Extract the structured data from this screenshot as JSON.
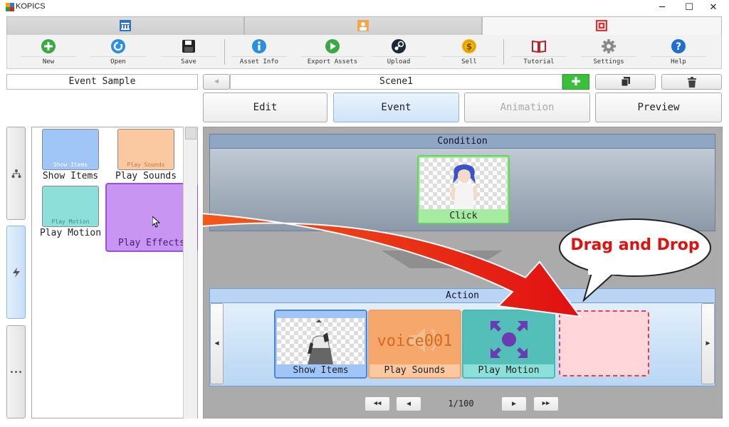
{
  "window": {
    "title": "KOPICS",
    "minimize": "─",
    "maximize": "☐",
    "close": "✕"
  },
  "toolbar": {
    "new": "New",
    "open": "Open",
    "save": "Save",
    "asset_info": "Asset Info",
    "export_assets": "Export Assets",
    "upload": "Upload",
    "sell": "Sell",
    "tutorial": "Tutorial",
    "settings": "Settings",
    "help": "Help"
  },
  "project": {
    "name": "Event Sample"
  },
  "scene": {
    "name": "Scene1",
    "prev": "◀",
    "add": "✚"
  },
  "modes": {
    "edit": "Edit",
    "event": "Event",
    "animation": "Animation",
    "preview": "Preview"
  },
  "palette": {
    "items": [
      {
        "mini": "Show Items",
        "label": "Show Items",
        "color": "#9fc6f7"
      },
      {
        "mini": "Play Sounds",
        "label": "Play Sounds",
        "color": "#fbc9a1"
      },
      {
        "mini": "Play Motion",
        "label": "Play Motion",
        "color": "#8ddfd9"
      },
      {
        "mini": "",
        "label": "Play Effects",
        "color": "#c896f2"
      }
    ]
  },
  "condition": {
    "title": "Condition",
    "card_label": "Click"
  },
  "action": {
    "title": "Action",
    "cards": [
      {
        "label": "Show Items"
      },
      {
        "label": "Play Sounds",
        "text": "voice001"
      },
      {
        "label": "Play Motion"
      }
    ],
    "left_arrow": "◀",
    "right_arrow": "▶"
  },
  "callout": {
    "text": "Drag and Drop"
  },
  "pager": {
    "first": "◀◀",
    "prev": "◀",
    "text": "1/100",
    "next": "▶",
    "last": "▶▶"
  },
  "sidebar": {
    "tool3": "•••"
  },
  "colors": {
    "accent_blue": "#d6e8fb",
    "callout_red": "#e0100f",
    "arrow_red": "#e8231a"
  }
}
